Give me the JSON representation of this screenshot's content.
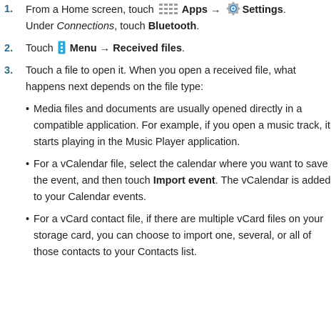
{
  "steps": [
    {
      "number": "1.",
      "line1_pre": "From a Home screen, touch",
      "apps_label": "Apps",
      "arrow": "→",
      "settings_label": "Settings",
      "line1_end": ".",
      "under": "Under",
      "connections": "Connections",
      "touch": ", touch",
      "bluetooth": "Bluetooth",
      "end": "."
    },
    {
      "number": "2.",
      "pre": "Touch",
      "menu_label": "Menu",
      "arrow": "→",
      "received_label": "Received files",
      "end": "."
    },
    {
      "number": "3.",
      "text": "Touch a file to open it. When you open a received file, what happens next depends on the file type:",
      "bullets": [
        {
          "text": "Media files and documents are usually opened directly in a compatible application. For example, if you open a music track, it starts playing in the Music Player application."
        },
        {
          "pre": "For a vCalendar file, select the calendar where you want to save the event, and then touch",
          "bold": "Import event",
          "post": ". The vCalendar is added to your Calendar events."
        },
        {
          "text": "For a vCard contact file, if there are multiple vCard files on your storage card, you can choose to import one, several, or all of those contacts to your Contacts list."
        }
      ]
    }
  ],
  "bullet_char": "•",
  "colors": {
    "step_number": "#2c6a8a",
    "icon_grid": "#9a9a9a",
    "gear_ring": "#3b8fd0",
    "menu_icon": "#2aa9d6"
  },
  "icons": [
    "apps-grid-icon",
    "settings-gear-icon",
    "menu-icon"
  ]
}
